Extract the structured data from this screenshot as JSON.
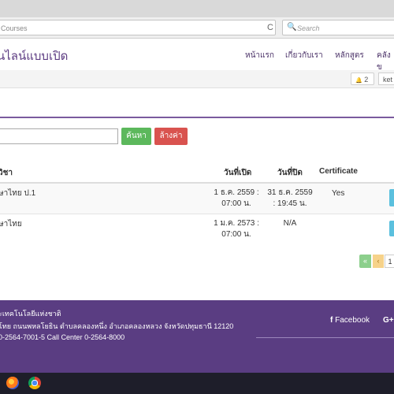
{
  "browser": {
    "url_text": "Courses",
    "search_placeholder": "Search",
    "reload_glyph": "C",
    "search_glyph": "🔍"
  },
  "site": {
    "brand": "นไลน์แบบเปิด",
    "nav": [
      "หน้าแรก",
      "เกี่ยวกับเรา",
      "หลักสูตร",
      "คลังข"
    ],
    "notification_count": "2",
    "bell_glyph": "🔔",
    "user_text": "ket"
  },
  "search_form": {
    "input_value": "",
    "search_label": "ค้นหา",
    "clear_label": "ล้างค่า"
  },
  "table": {
    "headers": [
      "วิชา",
      "วันที่เปิด",
      "วันที่ปิด",
      "Certificate"
    ],
    "rows": [
      {
        "course": "ษาไทย ป.1",
        "open_line1": "1 ธ.ค. 2559 :",
        "open_line2": "07:00 น.",
        "close_line1": "31 ธ.ค. 2559",
        "close_line2": ": 19:45 น.",
        "certificate": "Yes"
      },
      {
        "course": "ษาไทย",
        "open_line1": "1 ม.ค. 2573 :",
        "open_line2": "07:00 น.",
        "close_line1": "N/A",
        "close_line2": "",
        "certificate": ""
      }
    ]
  },
  "pagination": {
    "first": "«",
    "prev": "‹",
    "current": "1"
  },
  "footer": {
    "org_name": "ะเทคโนโลยีแห่งชาติ",
    "address": "โทย ถนนพหลโยธิน ตำบลคลองหนึ่ง อำเภอคลองหลวง จังหวัดปทุมธานี 12120",
    "phone": "0-2564-7001-5 Call Center 0-2564-8000",
    "facebook_glyph": "f",
    "facebook_label": "Facebook",
    "google_label": "G+"
  },
  "colors": {
    "brand_purple": "#5a3d82",
    "search_green": "#5cb85c",
    "clear_red": "#d9534f",
    "action_blue": "#5bc0de"
  }
}
